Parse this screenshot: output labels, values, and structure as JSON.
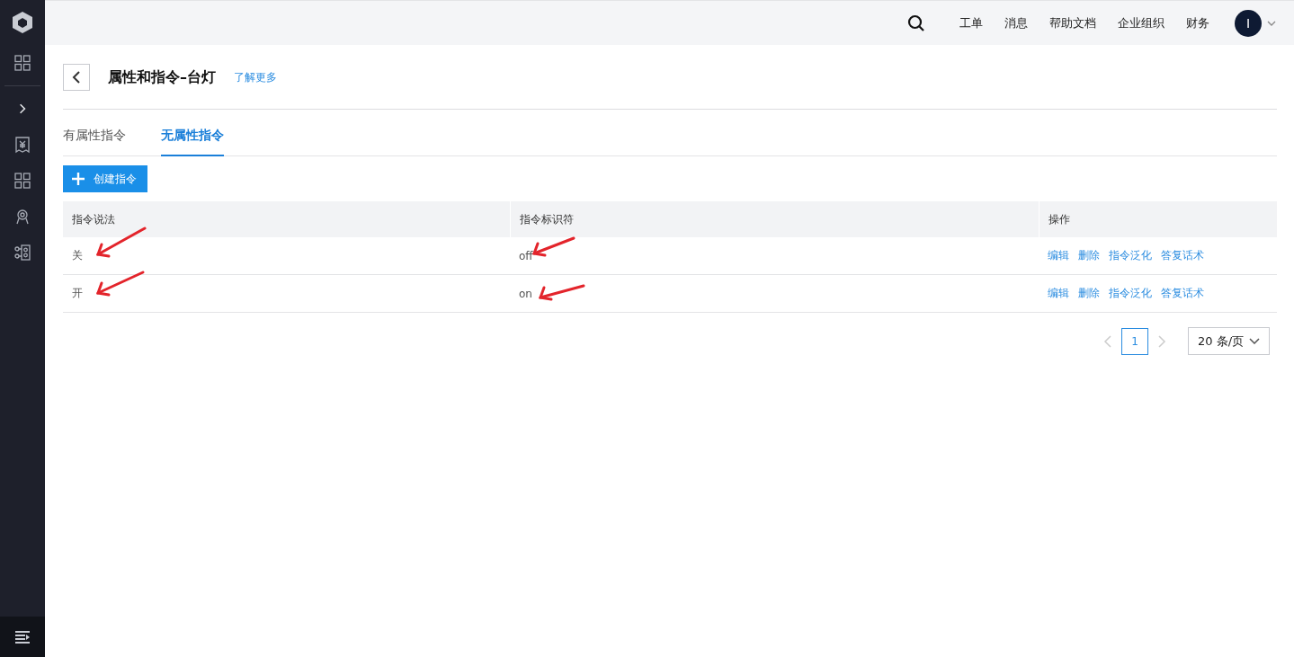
{
  "topbar": {
    "menu": [
      "工单",
      "消息",
      "帮助文档",
      "企业组织",
      "财务"
    ],
    "avatar": "I"
  },
  "header": {
    "title": "属性和指令–台灯",
    "link": "了解更多"
  },
  "tabs": [
    {
      "label": "有属性指令",
      "selected": false
    },
    {
      "label": "无属性指令",
      "selected": true
    }
  ],
  "create_button": "创建指令",
  "table": {
    "columns": [
      "指令说法",
      "指令标识符",
      "操作"
    ],
    "rows": [
      {
        "phrase": "关",
        "identifier": "off",
        "actions": [
          "编辑",
          "删除",
          "指令泛化",
          "答复话术"
        ]
      },
      {
        "phrase": "开",
        "identifier": "on",
        "actions": [
          "编辑",
          "删除",
          "指令泛化",
          "答复话术"
        ]
      }
    ]
  },
  "pagination": {
    "pages": [
      {
        "label": "1",
        "selected": true
      }
    ],
    "page_size": "20 条/页"
  }
}
